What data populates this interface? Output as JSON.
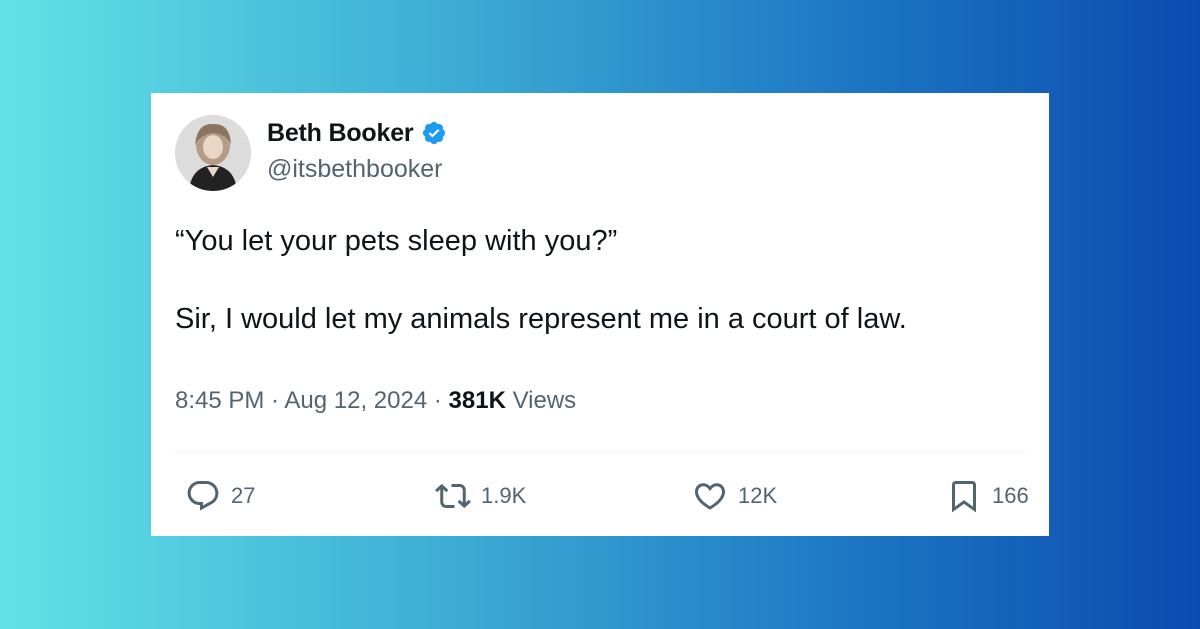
{
  "author": {
    "name": "Beth Booker",
    "handle": "@itsbethbooker",
    "verified": true,
    "verified_color": "#1d9bf0"
  },
  "tweet": {
    "lines": [
      "“You let your pets sleep with you?”",
      "Sir, I would let my animals represent me in a court of law."
    ]
  },
  "meta": {
    "time": "8:45 PM",
    "sep1": " · ",
    "date": "Aug 12, 2024",
    "sep2": " · ",
    "views_count": "381K",
    "views_label": " Views"
  },
  "actions": {
    "replies": "27",
    "retweets": "1.9K",
    "likes": "12K",
    "bookmarks": "166"
  },
  "icons": {
    "reply": "reply-icon",
    "retweet": "retweet-icon",
    "like": "heart-icon",
    "bookmark": "bookmark-icon",
    "verified": "verified-badge-icon"
  },
  "colors": {
    "text_primary": "#0f1419",
    "text_secondary": "#536471",
    "background_gradient_start": "#62e2e6",
    "background_gradient_end": "#0a4bb0"
  }
}
